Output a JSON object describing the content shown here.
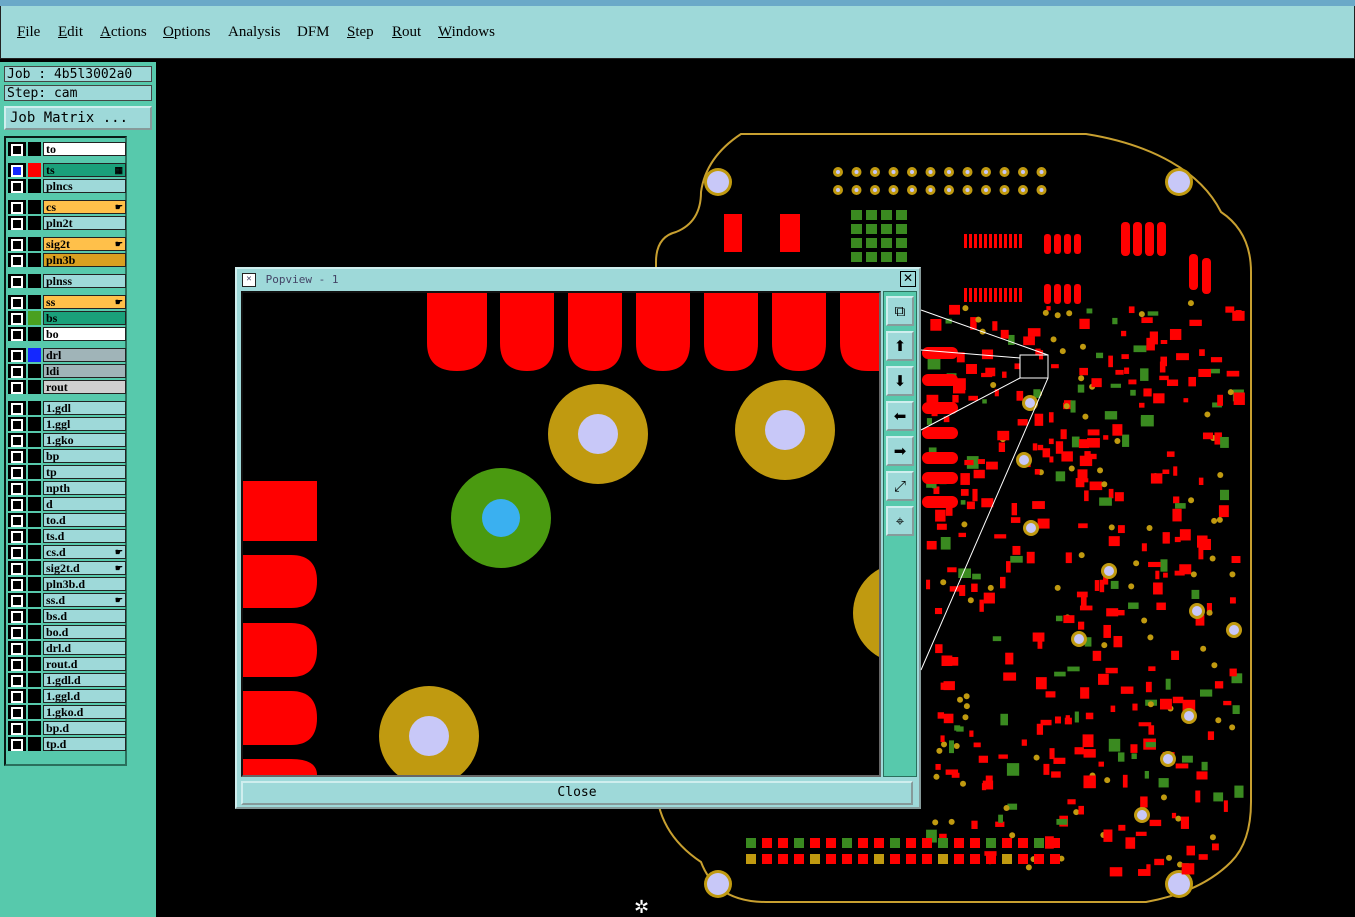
{
  "menu": {
    "items": [
      {
        "label": "File",
        "key": "F"
      },
      {
        "label": "Edit",
        "key": "E"
      },
      {
        "label": "Actions",
        "key": "A"
      },
      {
        "label": "Options",
        "key": "O"
      },
      {
        "label": "Analysis",
        "key": "A"
      },
      {
        "label": "DFM",
        "key": "D"
      },
      {
        "label": "Step",
        "key": "S"
      },
      {
        "label": "Rout",
        "key": "R"
      },
      {
        "label": "Windows",
        "key": "W"
      }
    ]
  },
  "panel": {
    "job_label": "Job : 4b5l3002a0",
    "step_label": "Step: cam",
    "job_matrix_button": "Job Matrix ..."
  },
  "layers": [
    {
      "name": "to",
      "bg": "#ffffff",
      "swatch": "#000000",
      "mark": ""
    },
    {
      "name": "ts",
      "bg": "#1aa07a",
      "swatch": "#ff0000",
      "mark": "grid",
      "checked": true
    },
    {
      "name": "plncs",
      "bg": "#9ed9d9",
      "swatch": "#000000",
      "mark": ""
    },
    {
      "name": "cs",
      "bg": "#ffc04a",
      "swatch": "#000000",
      "mark": "hand"
    },
    {
      "name": "pln2t",
      "bg": "#9ed9d9",
      "swatch": "#000000",
      "mark": ""
    },
    {
      "name": "sig2t",
      "bg": "#ffc04a",
      "swatch": "#000000",
      "mark": "hand"
    },
    {
      "name": "pln3b",
      "bg": "#d9a020",
      "swatch": "#000000",
      "mark": ""
    },
    {
      "name": "plnss",
      "bg": "#9ed9d9",
      "swatch": "#000000",
      "mark": ""
    },
    {
      "name": "ss",
      "bg": "#ffc04a",
      "swatch": "#000000",
      "mark": "hand"
    },
    {
      "name": "bs",
      "bg": "#1aa07a",
      "swatch": "#4aa020",
      "mark": ""
    },
    {
      "name": "bo",
      "bg": "#ffffff",
      "swatch": "#000000",
      "mark": ""
    },
    {
      "name": "drl",
      "bg": "#a0b4b8",
      "swatch": "#1428ff",
      "mark": ""
    },
    {
      "name": "ldi",
      "bg": "#a0b4b8",
      "swatch": "#000000",
      "mark": ""
    },
    {
      "name": "rout",
      "bg": "#d0d0d0",
      "swatch": "#000000",
      "mark": ""
    },
    {
      "name": "1.gdl",
      "bg": "#9ed9d9",
      "swatch": "#000000",
      "mark": ""
    },
    {
      "name": "1.ggl",
      "bg": "#9ed9d9",
      "swatch": "#000000",
      "mark": ""
    },
    {
      "name": "1.gko",
      "bg": "#9ed9d9",
      "swatch": "#000000",
      "mark": ""
    },
    {
      "name": "bp",
      "bg": "#9ed9d9",
      "swatch": "#000000",
      "mark": ""
    },
    {
      "name": "tp",
      "bg": "#9ed9d9",
      "swatch": "#000000",
      "mark": ""
    },
    {
      "name": "npth",
      "bg": "#9ed9d9",
      "swatch": "#000000",
      "mark": ""
    },
    {
      "name": "d",
      "bg": "#9ed9d9",
      "swatch": "#000000",
      "mark": ""
    },
    {
      "name": "to.d",
      "bg": "#9ed9d9",
      "swatch": "#000000",
      "mark": ""
    },
    {
      "name": "ts.d",
      "bg": "#9ed9d9",
      "swatch": "#000000",
      "mark": ""
    },
    {
      "name": "cs.d",
      "bg": "#9ed9d9",
      "swatch": "#000000",
      "mark": "hand"
    },
    {
      "name": "sig2t.d",
      "bg": "#9ed9d9",
      "swatch": "#000000",
      "mark": "hand"
    },
    {
      "name": "pln3b.d",
      "bg": "#9ed9d9",
      "swatch": "#000000",
      "mark": ""
    },
    {
      "name": "ss.d",
      "bg": "#9ed9d9",
      "swatch": "#000000",
      "mark": "hand"
    },
    {
      "name": "bs.d",
      "bg": "#9ed9d9",
      "swatch": "#000000",
      "mark": ""
    },
    {
      "name": "bo.d",
      "bg": "#9ed9d9",
      "swatch": "#000000",
      "mark": ""
    },
    {
      "name": "drl.d",
      "bg": "#9ed9d9",
      "swatch": "#000000",
      "mark": ""
    },
    {
      "name": "rout.d",
      "bg": "#9ed9d9",
      "swatch": "#000000",
      "mark": ""
    },
    {
      "name": "1.gdl.d",
      "bg": "#9ed9d9",
      "swatch": "#000000",
      "mark": ""
    },
    {
      "name": "1.ggl.d",
      "bg": "#9ed9d9",
      "swatch": "#000000",
      "mark": ""
    },
    {
      "name": "1.gko.d",
      "bg": "#9ed9d9",
      "swatch": "#000000",
      "mark": ""
    },
    {
      "name": "bp.d",
      "bg": "#9ed9d9",
      "swatch": "#000000",
      "mark": ""
    },
    {
      "name": "tp.d",
      "bg": "#9ed9d9",
      "swatch": "#000000",
      "mark": ""
    }
  ],
  "popview": {
    "title": "Popview - 1",
    "close_x": "✕",
    "close_button": "Close",
    "tools": [
      "zoom-window-icon",
      "pan-up-icon",
      "pan-down-icon",
      "pan-left-icon",
      "pan-right-icon",
      "zoom-fit-icon",
      "zoom-home-icon"
    ]
  },
  "colors": {
    "pad": "#ff0000",
    "ring_gold": "#c09a10",
    "ring_green": "#4a9a10",
    "drill_lavender": "#c8c8f8",
    "drill_blue": "#3ab0f0",
    "outline": "#c8a030",
    "smd_green": "#3a8a20"
  }
}
